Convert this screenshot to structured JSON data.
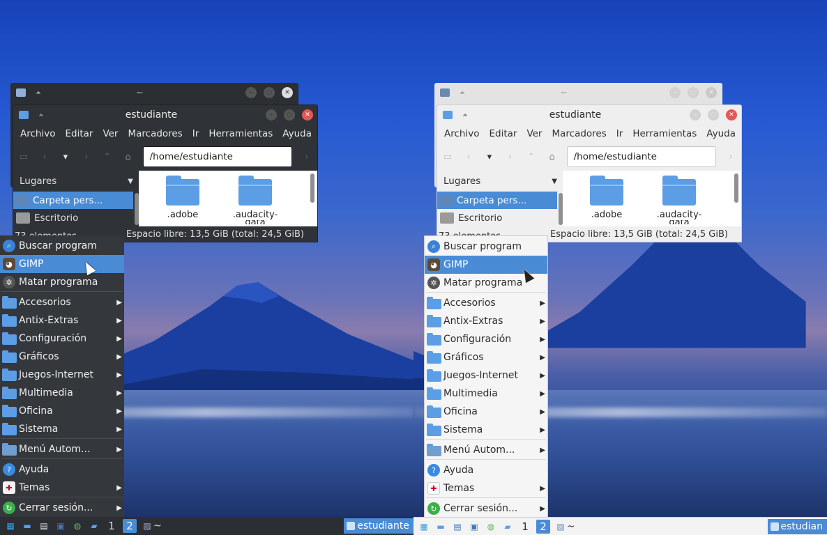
{
  "colors": {
    "accent": "#4a8bd6",
    "folder": "#5b9ee6",
    "close": "#e05a55",
    "dark_panel": "#34373c",
    "light_panel": "#f5f5f5"
  },
  "back_window": {
    "title": "~"
  },
  "file_manager": {
    "title": "estudiante",
    "menus": [
      "Archivo",
      "Editar",
      "Ver",
      "Marcadores",
      "Ir",
      "Herramientas",
      "Ayuda"
    ],
    "address": "/home/estudiante",
    "sidebar_header": "Lugares",
    "sidebar_items": [
      "Carpeta pers...",
      "Escritorio"
    ],
    "files": [
      ".adobe",
      ".audacity-"
    ],
    "files_cut": "data",
    "item_count": "73 elementos",
    "free_space": "Espacio libre: 13,5 GiB (total: 24,5 GiB)"
  },
  "menu": {
    "items": [
      {
        "label": "Buscar program",
        "icon": "search-icon"
      },
      {
        "label": "GIMP",
        "icon": "gimp-icon"
      },
      {
        "label": "Matar programa",
        "icon": "gear-icon"
      },
      {
        "label": "Accesorios",
        "icon": "folder-icon"
      },
      {
        "label": "Antix-Extras",
        "icon": "folder-icon"
      },
      {
        "label": "Configuración",
        "icon": "folder-icon"
      },
      {
        "label": "Gráficos",
        "icon": "folder-icon"
      },
      {
        "label": "Juegos-Internet",
        "icon": "folder-icon"
      },
      {
        "label": "Multimedia",
        "icon": "folder-icon"
      },
      {
        "label": "Oficina",
        "icon": "folder-icon"
      },
      {
        "label": "Sistema",
        "icon": "folder-icon"
      },
      {
        "label": "Menú Autom...",
        "icon": "auto-menu-icon"
      },
      {
        "label": "Ayuda",
        "icon": "help-icon"
      },
      {
        "label": "Temas",
        "icon": "theme-icon"
      },
      {
        "label": "Cerrar sesión...",
        "icon": "logout-icon"
      }
    ]
  },
  "taskbar": {
    "workspaces": [
      "1",
      "2"
    ],
    "tilde": "~",
    "task_label_left": "estudiante",
    "task_label_right": "estudian"
  }
}
